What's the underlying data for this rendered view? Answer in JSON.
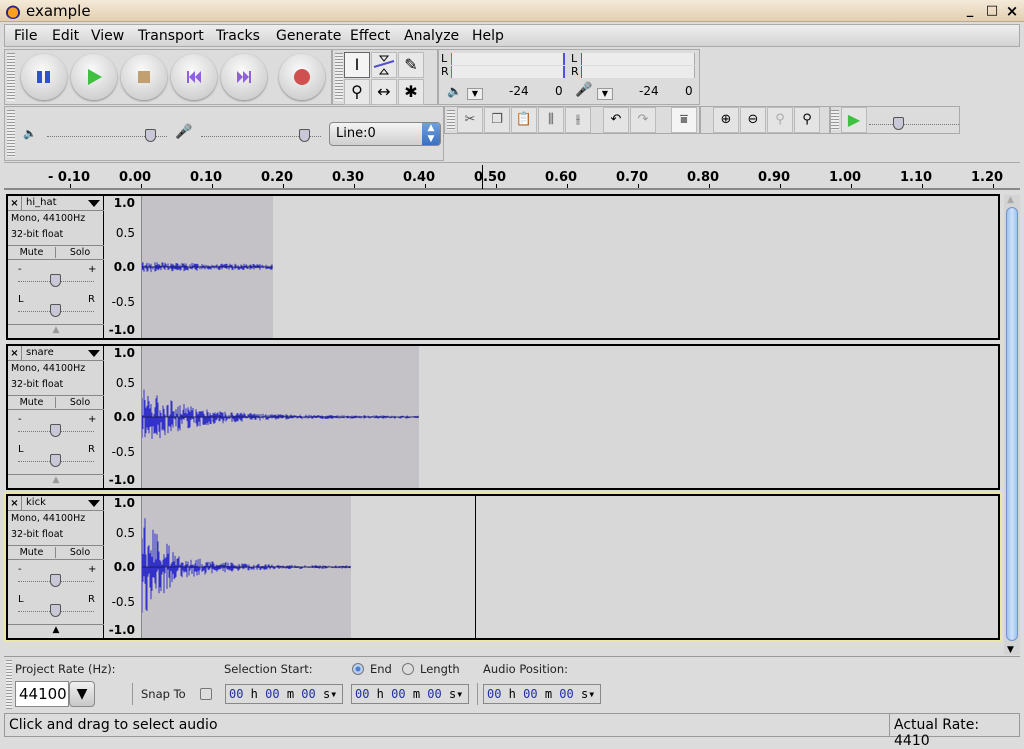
{
  "window": {
    "title": "example",
    "minimize": "_",
    "maximize": "□",
    "close": "×"
  },
  "menu": [
    "File",
    "Edit",
    "View",
    "Transport",
    "Tracks",
    "Generate",
    "Effect",
    "Analyze",
    "Help"
  ],
  "transport": {
    "buttons": [
      "pause",
      "play",
      "stop",
      "skip-to-start",
      "skip-to-end",
      "record"
    ]
  },
  "tools": [
    "selection-tool",
    "envelope-tool",
    "draw-tool",
    "zoom-tool",
    "timeshift-tool",
    "multi-tool"
  ],
  "meters": {
    "output": {
      "L": "L",
      "R": "R",
      "scale": [
        "-24",
        "0"
      ]
    },
    "input": {
      "L": "L",
      "R": "R",
      "scale": [
        "-24",
        "0"
      ]
    }
  },
  "mixer": {
    "output_volume": 0.85,
    "input_volume": 0.85,
    "input_source": "Line:0"
  },
  "playback_speed": 0.3,
  "ruler": {
    "ticks": [
      "- 0.10",
      "0.00",
      "0.10",
      "0.20",
      "0.30",
      "0.40",
      "0.50",
      "0.60",
      "0.70",
      "0.80",
      "0.90",
      "1.00",
      "1.10",
      "1.20"
    ]
  },
  "tracks": [
    {
      "name": "hi_hat",
      "format": "Mono, 44100Hz",
      "bits": "32-bit float",
      "mute": "Mute",
      "solo": "Solo",
      "gain_minus": "-",
      "gain_plus": "+",
      "pan_left": "L",
      "pan_right": "R",
      "scale": [
        "1.0",
        "0.5",
        "0.0",
        "-0.5",
        "-1.0"
      ],
      "clip_end": 0.185,
      "selected": false
    },
    {
      "name": "snare",
      "format": "Mono, 44100Hz",
      "bits": "32-bit float",
      "mute": "Mute",
      "solo": "Solo",
      "gain_minus": "-",
      "gain_plus": "+",
      "pan_left": "L",
      "pan_right": "R",
      "scale": [
        "1.0",
        "0.5",
        "0.0",
        "-0.5",
        "-1.0"
      ],
      "clip_end": 0.39,
      "selected": false
    },
    {
      "name": "kick",
      "format": "Mono, 44100Hz",
      "bits": "32-bit float",
      "mute": "Mute",
      "solo": "Solo",
      "gain_minus": "-",
      "gain_plus": "+",
      "pan_left": "L",
      "pan_right": "R",
      "scale": [
        "1.0",
        "0.5",
        "0.0",
        "-0.5",
        "-1.0"
      ],
      "clip_end": 0.295,
      "selected": true
    }
  ],
  "cursor_position": 0.48,
  "bottom": {
    "project_rate_label": "Project Rate (Hz):",
    "project_rate": "44100",
    "snap_to": "Snap To",
    "selection_start_label": "Selection Start:",
    "end_label": "End",
    "length_label": "Length",
    "audio_position_label": "Audio Position:",
    "selection_start": {
      "h": "00",
      "m": "00",
      "s": "00"
    },
    "selection_end": {
      "h": "00",
      "m": "00",
      "s": "00"
    },
    "audio_position": {
      "h": "00",
      "m": "00",
      "s": "00"
    }
  },
  "status": {
    "message": "Click and drag to select audio",
    "actual_rate": "Actual Rate: 4410"
  }
}
